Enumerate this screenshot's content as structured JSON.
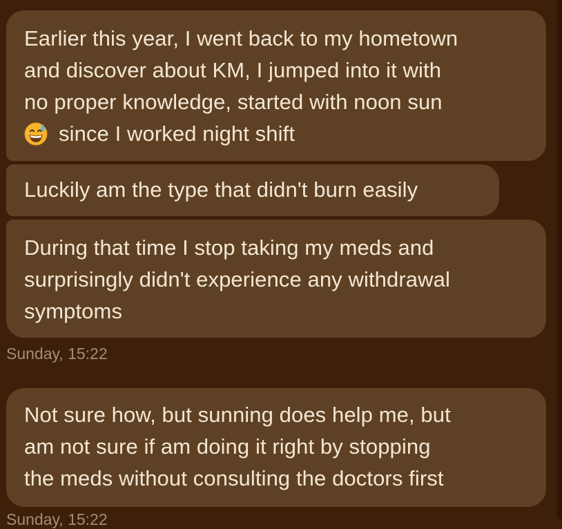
{
  "conversation": {
    "messages": [
      {
        "lines": [
          "Earlier this year, I went back to my hometown",
          "and discover about KM, I jumped into it with",
          "no proper knowledge, started with noon sun",
          "since I worked night shift"
        ],
        "emoji": "grinning-face-with-sweat"
      },
      {
        "lines": [
          "Luckily am the type that didn't burn easily"
        ]
      },
      {
        "lines": [
          "During that time I stop taking my meds and",
          "surprisingly didn't experience any withdrawal",
          "symptoms"
        ]
      },
      {
        "lines": [
          "Not sure how, but sunning does help me, but",
          "am not sure if am doing it right by stopping",
          "the meds without consulting the doctors first"
        ]
      }
    ],
    "timestamps": [
      "Sunday, 15:22",
      "Sunday, 15:22"
    ]
  },
  "colors": {
    "background": "#3d1f0a",
    "bubble": "#5e4125",
    "message_text": "#f3e6d4",
    "timestamp_text": "#a38e76"
  }
}
